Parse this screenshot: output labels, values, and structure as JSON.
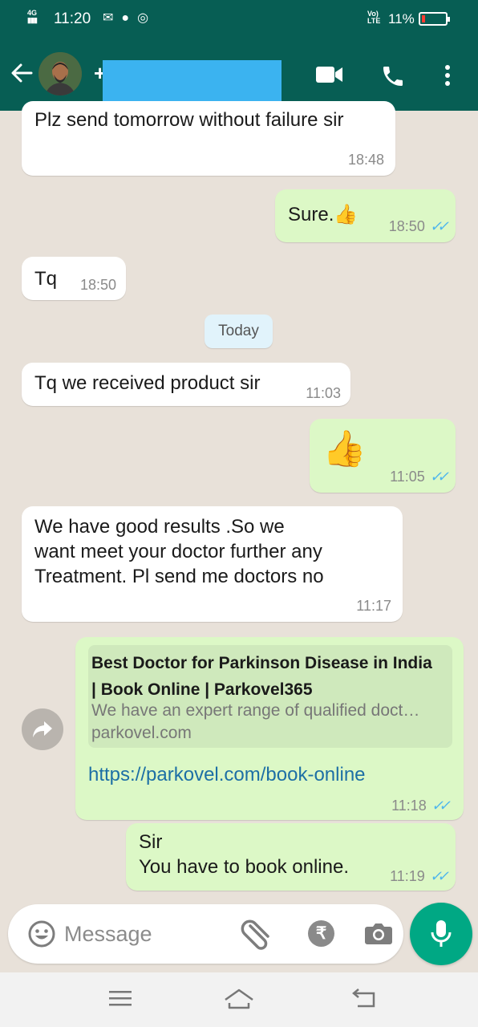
{
  "status_bar": {
    "network": "4G",
    "time": "11:20",
    "volte_top": "VoLTE",
    "battery_pct": "11%"
  },
  "header": {
    "contact_prefix": "+",
    "icons": [
      "back-arrow-icon",
      "video-call-icon",
      "phone-icon",
      "more-vert-icon"
    ]
  },
  "messages": [
    {
      "dir": "in",
      "text": "Plz send tomorrow without failure sir",
      "time": "18:48"
    },
    {
      "dir": "out",
      "text": "Sure.👍",
      "time": "18:50",
      "ticks": "✓✓"
    },
    {
      "dir": "in",
      "text": "Tq",
      "time": "18:50"
    },
    {
      "dir": "in",
      "text": "Tq we received product sir",
      "time": "11:03"
    },
    {
      "dir": "out",
      "text": "👍",
      "time": "11:05",
      "ticks": "✓✓"
    },
    {
      "dir": "in",
      "text_lines": [
        "We have good results .So we",
        "want meet your doctor further any",
        "Treatment. Pl send me doctors no"
      ],
      "time": "11:17"
    },
    {
      "dir": "out",
      "link_preview": {
        "title_lines": [
          "Best Doctor for Parkinson Disease in India",
          "| Book Online | Parkovel365"
        ],
        "description": "We have an expert range of qualified doct…",
        "domain": "parkovel.com"
      },
      "url": "https://parkovel.com/book-online",
      "time": "11:18",
      "ticks": "✓✓"
    },
    {
      "dir": "out",
      "text_lines": [
        "Sir",
        "You have to book online."
      ],
      "time": "11:19",
      "ticks": "✓✓"
    }
  ],
  "date_separator": "Today",
  "composer": {
    "placeholder": "Message",
    "currency_symbol": "₹"
  },
  "colors": {
    "header_green": "#075e54",
    "outgoing_bubble": "#dcf8c6",
    "incoming_bubble": "#ffffff",
    "read_ticks": "#4fb6ec",
    "mic_button": "#00a884"
  }
}
